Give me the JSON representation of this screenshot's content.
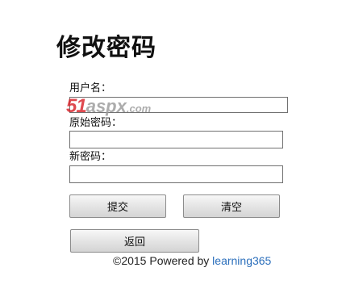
{
  "page": {
    "title": "修改密码"
  },
  "form": {
    "username_label": "用户名：",
    "username_value": "",
    "old_password_label": "原始密码：",
    "old_password_value": "",
    "new_password_label": "新密码：",
    "new_password_value": ""
  },
  "buttons": {
    "submit": "提交",
    "clear": "清空",
    "back": "返回"
  },
  "footer": {
    "copyright": "©2015 Powered by ",
    "link_text": "learning365"
  },
  "watermark": {
    "number": "51",
    "brand": "aspx",
    "suffix": ".com",
    "colors": {
      "number": "#d8232a",
      "brand": "#9a9a9a"
    }
  },
  "colors": {
    "link": "#2a6ebb"
  }
}
